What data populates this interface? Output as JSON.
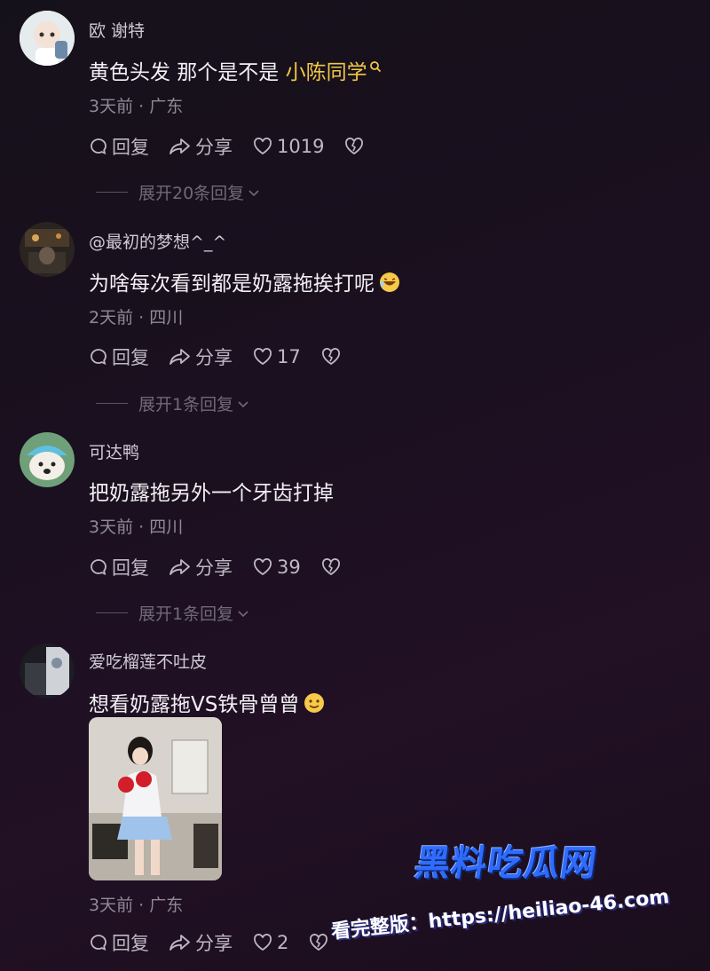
{
  "comments": [
    {
      "username": "欧 谢特",
      "text": "黄色头发 那个是不是 ",
      "mention": "小陈同学",
      "meta": "3天前 · 广东",
      "reply_label": "回复",
      "share_label": "分享",
      "likes": "1019",
      "expand_label": "展开20条回复"
    },
    {
      "username": "@最初的梦想^_^",
      "text": "为啥每次看到都是奶露拖挨打呢",
      "meta": "2天前 · 四川",
      "reply_label": "回复",
      "share_label": "分享",
      "likes": "17",
      "expand_label": "展开1条回复"
    },
    {
      "username": "可达鸭",
      "text": "把奶露拖另外一个牙齿打掉",
      "meta": "3天前 · 四川",
      "reply_label": "回复",
      "share_label": "分享",
      "likes": "39",
      "expand_label": "展开1条回复"
    },
    {
      "username": "爱吃榴莲不吐皮",
      "text": "想看奶露拖VS铁骨曾曾",
      "meta": "3天前 · 广东",
      "reply_label": "回复",
      "share_label": "分享",
      "likes": "2"
    }
  ],
  "watermark": {
    "logo": "黑料吃瓜网",
    "url": "看完整版：https://heiliao-46.com"
  },
  "colors": {
    "mention": "#f2c745",
    "background": "#1b1020",
    "watermark_blue": "#2f6bff"
  },
  "icons": [
    "comment-icon",
    "share-icon",
    "heart-icon",
    "broken-heart-icon",
    "search-icon",
    "chevron-down-icon"
  ]
}
